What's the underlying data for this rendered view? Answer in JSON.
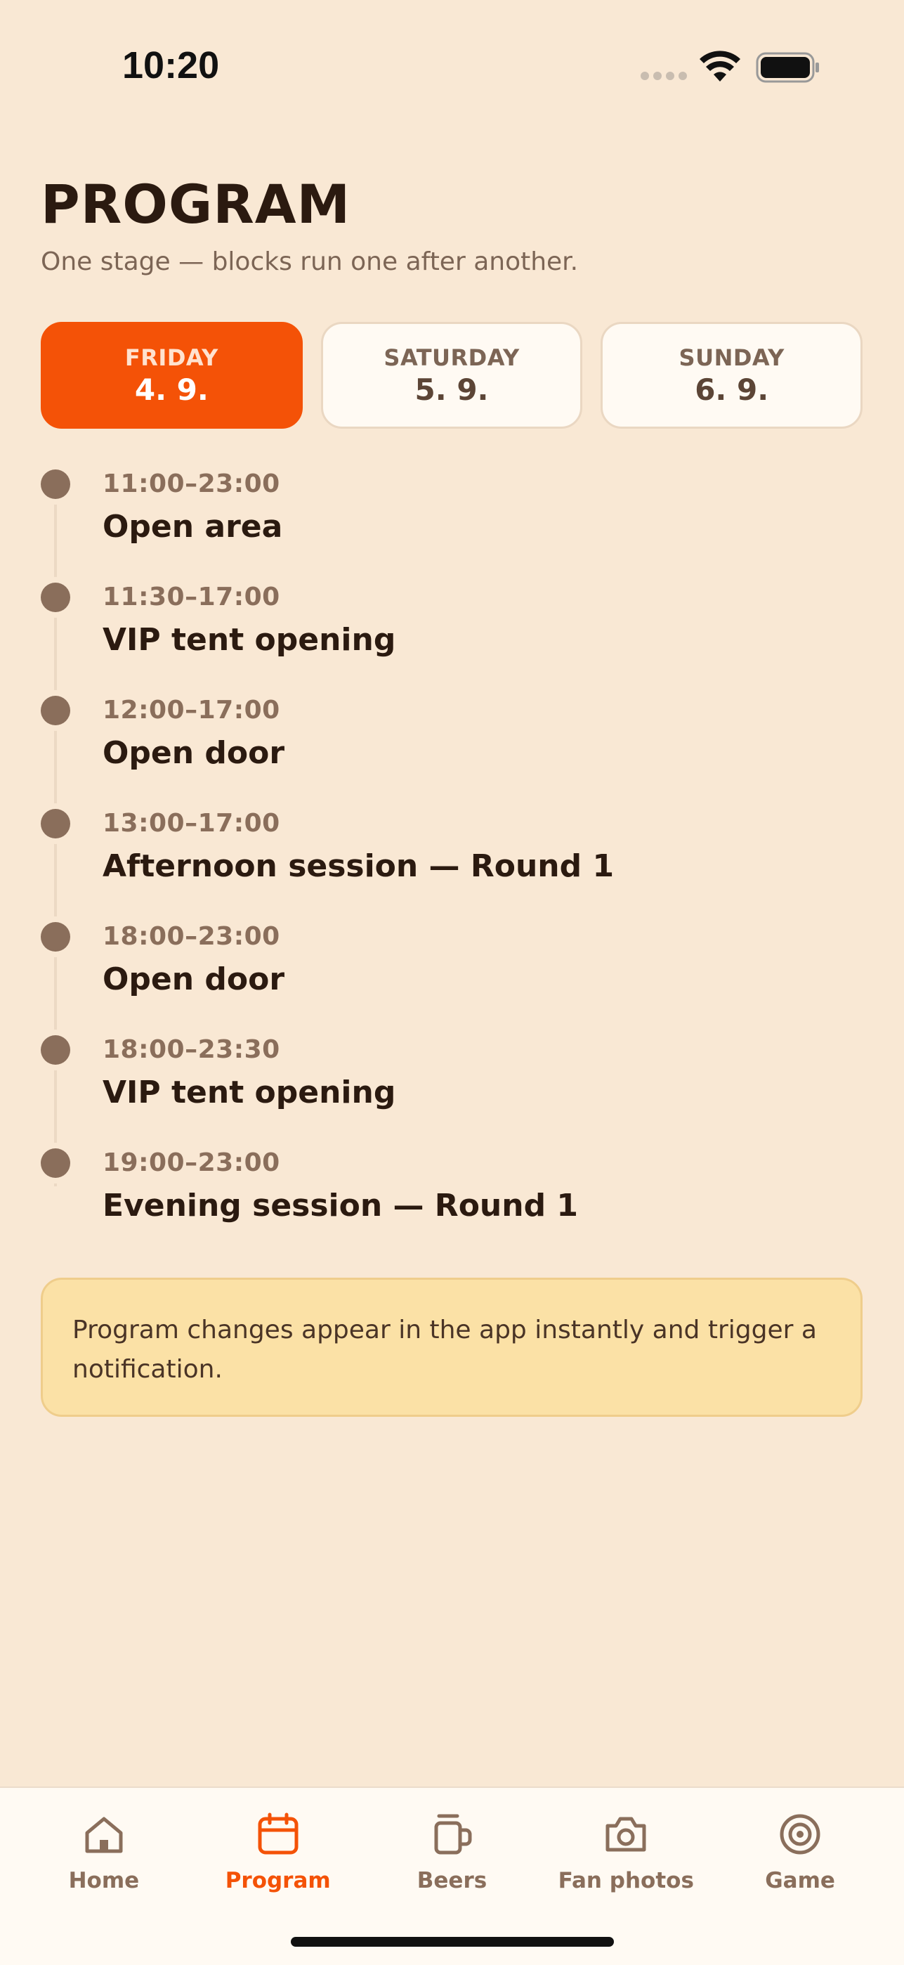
{
  "status_bar": {
    "time": "10:20"
  },
  "header": {
    "title": "PROGRAM",
    "subtitle": "One stage — blocks run one after another."
  },
  "days": [
    {
      "name": "FRIDAY",
      "date": "4. 9.",
      "active": true
    },
    {
      "name": "SATURDAY",
      "date": "5. 9.",
      "active": false
    },
    {
      "name": "SUNDAY",
      "date": "6. 9.",
      "active": false
    }
  ],
  "events": [
    {
      "time": "11:00–23:00",
      "title": "Open area"
    },
    {
      "time": "11:30–17:00",
      "title": "VIP tent opening"
    },
    {
      "time": "12:00–17:00",
      "title": "Open door"
    },
    {
      "time": "13:00–17:00",
      "title": "Afternoon session — Round 1"
    },
    {
      "time": "18:00–23:00",
      "title": "Open door"
    },
    {
      "time": "18:00–23:30",
      "title": "VIP tent opening"
    },
    {
      "time": "19:00–23:00",
      "title": "Evening session — Round 1"
    }
  ],
  "notice": {
    "text": "Program changes appear in the app instantly and trigger a notification."
  },
  "nav": [
    {
      "label": "Home",
      "icon": "home-icon",
      "active": false
    },
    {
      "label": "Program",
      "icon": "calendar-icon",
      "active": true
    },
    {
      "label": "Beers",
      "icon": "beer-mug-icon",
      "active": false
    },
    {
      "label": "Fan photos",
      "icon": "camera-icon",
      "active": false
    },
    {
      "label": "Game",
      "icon": "target-icon",
      "active": false
    }
  ],
  "colors": {
    "background": "#f9e8d4",
    "accent": "#f45207",
    "muted": "#8a6e5b",
    "notice_bg": "#fbe1a6"
  }
}
